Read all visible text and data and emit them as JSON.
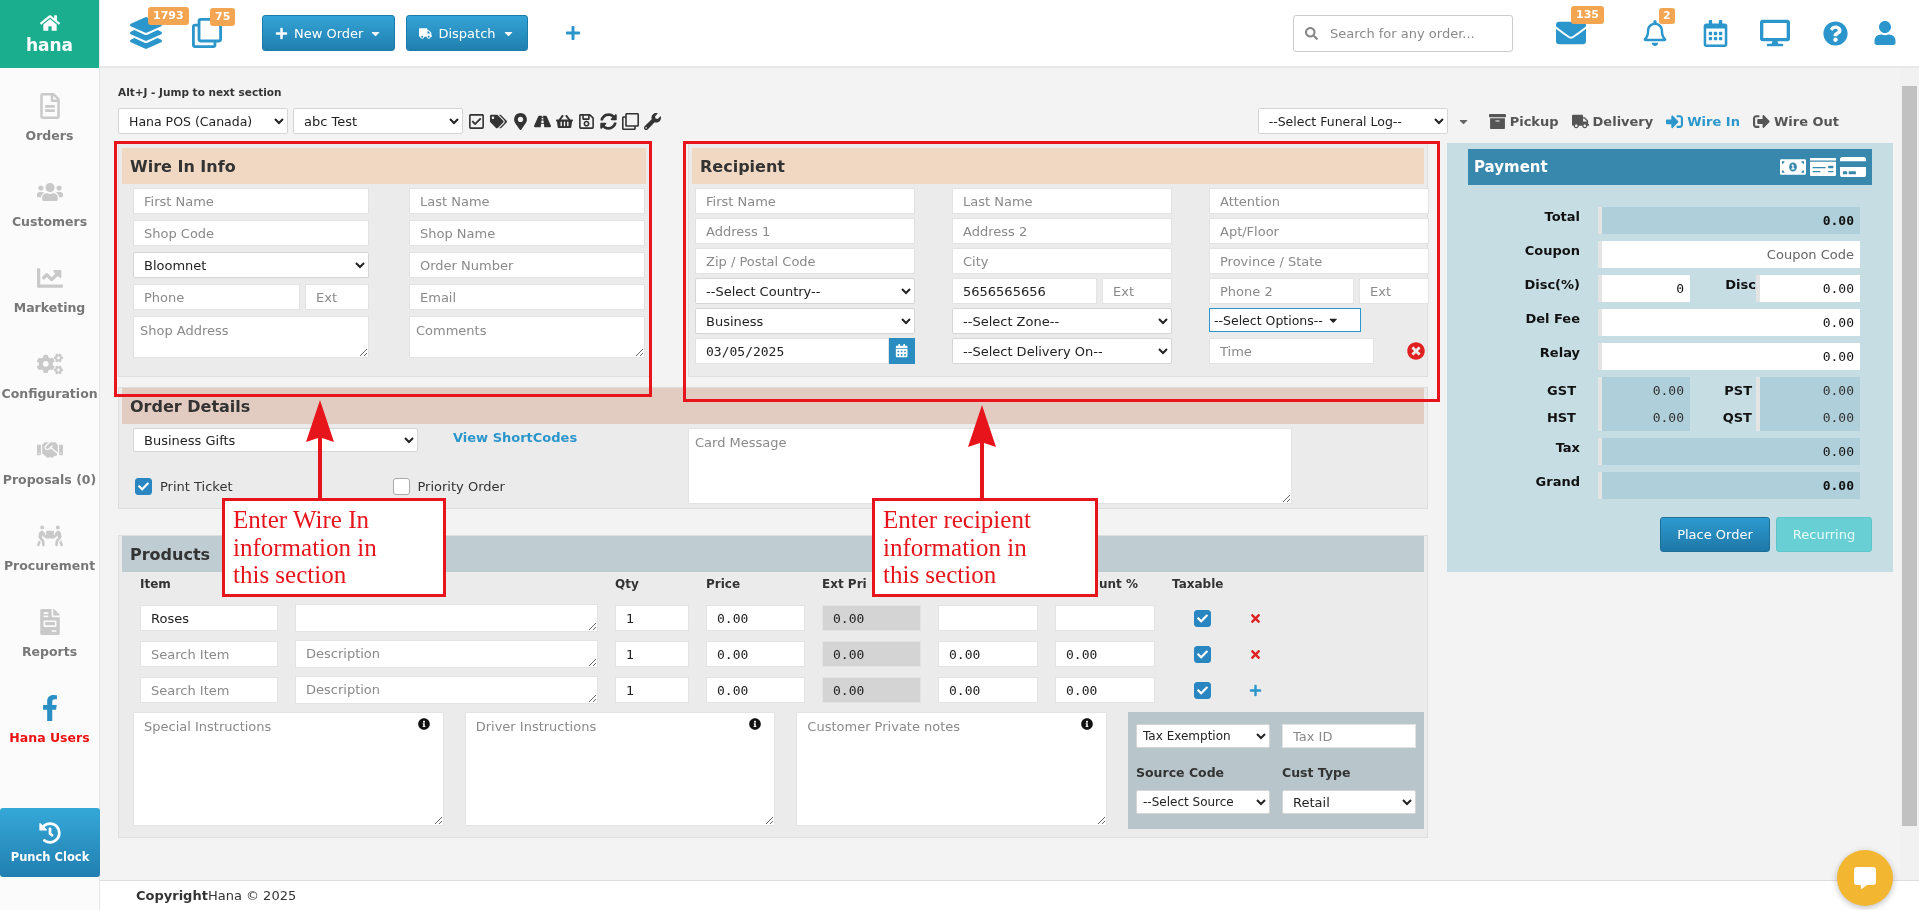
{
  "sidebar": {
    "logo": "hana",
    "items": [
      {
        "label": "Orders",
        "kind": "nav"
      },
      {
        "label": "Customers",
        "kind": "nav"
      },
      {
        "label": "Marketing",
        "kind": "nav"
      },
      {
        "label": "Configuration",
        "kind": "nav"
      },
      {
        "label": "Proposals (0)",
        "kind": "nav"
      },
      {
        "label": "Procurement",
        "kind": "nav"
      },
      {
        "label": "Reports",
        "kind": "nav"
      },
      {
        "label": "Hana Users",
        "kind": "social"
      }
    ],
    "punch_clock": "Punch Clock"
  },
  "topbar": {
    "badges": [
      "1793",
      "75"
    ],
    "buttons": [
      "New Order",
      "Dispatch"
    ],
    "search": {
      "placeholder": "Search for any order..."
    },
    "mail_count": "135",
    "notification_count": "2"
  },
  "toolbar": {
    "hint": "Alt+J - Jump to next section",
    "store": "Hana POS (Canada)",
    "user": "abc Test",
    "funeral_log": "--Select Funeral Log--",
    "order_types": [
      {
        "label": "Pickup",
        "selected": false
      },
      {
        "label": "Delivery",
        "selected": false
      },
      {
        "label": "Wire In",
        "selected": true
      },
      {
        "label": "Wire Out",
        "selected": false
      }
    ]
  },
  "wire_in": {
    "title": "Wire In Info",
    "rows": [
      [
        {
          "kind": "input",
          "placeholder": "First Name"
        },
        {
          "kind": "input",
          "placeholder": "Last Name"
        }
      ],
      [
        {
          "kind": "input",
          "placeholder": "Shop Code"
        },
        {
          "kind": "input",
          "placeholder": "Shop Name"
        }
      ],
      [
        {
          "kind": "select",
          "value": "Bloomnet"
        },
        {
          "kind": "input",
          "placeholder": "Order Number"
        }
      ],
      [
        {
          "kind": "split",
          "fields": [
            {
              "kind": "input",
              "placeholder": "Phone"
            },
            {
              "kind": "input",
              "placeholder": "Ext"
            }
          ]
        },
        {
          "kind": "input",
          "placeholder": "Email"
        }
      ],
      [
        {
          "kind": "textarea",
          "placeholder": "Shop Address"
        },
        {
          "kind": "textarea",
          "placeholder": "Comments"
        }
      ]
    ]
  },
  "recipient": {
    "title": "Recipient",
    "rows": [
      [
        {
          "kind": "input",
          "placeholder": "First Name"
        },
        {
          "kind": "input",
          "placeholder": "Last Name"
        },
        {
          "kind": "input",
          "placeholder": "Attention"
        }
      ],
      [
        {
          "kind": "input",
          "placeholder": "Address 1"
        },
        {
          "kind": "input",
          "placeholder": "Address 2"
        },
        {
          "kind": "input",
          "placeholder": "Apt/Floor"
        }
      ],
      [
        {
          "kind": "input",
          "placeholder": "Zip / Postal Code"
        },
        {
          "kind": "input",
          "placeholder": "City"
        },
        {
          "kind": "input",
          "placeholder": "Province / State"
        }
      ],
      [
        {
          "kind": "select",
          "value": "--Select Country--"
        },
        {
          "kind": "split",
          "fields": [
            {
              "kind": "input",
              "value": "5656565656"
            },
            {
              "kind": "input",
              "placeholder": "Ext"
            }
          ]
        },
        {
          "kind": "split",
          "fields": [
            {
              "kind": "input",
              "placeholder": "Phone 2"
            },
            {
              "kind": "input",
              "placeholder": "Ext"
            }
          ]
        }
      ],
      [
        {
          "kind": "select",
          "value": "Business"
        },
        {
          "kind": "select",
          "value": "--Select Zone--"
        },
        {
          "kind": "options",
          "value": "--Select Options--"
        }
      ],
      [
        {
          "kind": "date",
          "value": "03/05/2025"
        },
        {
          "kind": "select",
          "value": "--Select Delivery On--"
        },
        {
          "kind": "time",
          "placeholder": "Time"
        }
      ]
    ]
  },
  "order_details": {
    "title": "Order Details",
    "occasion": "Business Gifts",
    "shortcodes_link": "View ShortCodes",
    "card_message": {
      "placeholder": "Card Message"
    },
    "checks": [
      {
        "label": "Print Ticket",
        "checked": true
      },
      {
        "label": "Priority Order",
        "checked": false
      }
    ]
  },
  "products": {
    "title": "Products",
    "columns": [
      "Item",
      "Qty",
      "Price",
      "Ext Pri",
      "unt %",
      "Taxable"
    ],
    "rows": [
      {
        "item": {
          "value": "Roses"
        },
        "description": {},
        "qty": "1",
        "price": "0.00",
        "ext_price": "0.00",
        "taxable": true,
        "kind": "existing"
      },
      {
        "item": {
          "placeholder": "Search Item"
        },
        "description": {
          "placeholder": "Description"
        },
        "qty": "1",
        "price": "0.00",
        "ext_price": "0.00",
        "discount": "0.00",
        "discount_pct": "0.00",
        "taxable": true,
        "kind": "existing"
      },
      {
        "item": {
          "placeholder": "Search Item"
        },
        "description": {
          "placeholder": "Description"
        },
        "qty": "1",
        "price": "0.00",
        "ext_price": "0.00",
        "discount": "0.00",
        "discount_pct": "0.00",
        "taxable": true,
        "kind": "new"
      }
    ],
    "notes": [
      {
        "placeholder": "Special Instructions"
      },
      {
        "placeholder": "Driver Instructions"
      },
      {
        "placeholder": "Customer Private notes"
      }
    ],
    "tax_exemption": "Tax Exemption",
    "tax_id": {
      "placeholder": "Tax ID"
    },
    "source_code": {
      "label": "Source Code",
      "value": "--Select Source"
    },
    "cust_type": {
      "label": "Cust Type",
      "value": "Retail"
    }
  },
  "payment": {
    "title": "Payment",
    "rows": [
      {
        "kind": "readonly",
        "strong": true,
        "label": "Total",
        "value": "0.00"
      },
      {
        "kind": "input",
        "label": "Coupon",
        "placeholder": "Coupon Code"
      },
      {
        "kind": "pair",
        "items": [
          {
            "label": "Disc(%)",
            "value": "0"
          },
          {
            "label": "Disc",
            "value": "0.00"
          }
        ]
      },
      {
        "kind": "input",
        "label": "Del Fee",
        "value": "0.00"
      },
      {
        "kind": "input",
        "label": "Relay",
        "value": "0.00"
      },
      {
        "kind": "taxes",
        "items": [
          {
            "label": "GST",
            "value": "0.00"
          },
          {
            "label": "PST",
            "value": "0.00"
          },
          {
            "label": "HST",
            "value": "0.00"
          },
          {
            "label": "QST",
            "value": "0.00"
          }
        ]
      },
      {
        "kind": "readonly",
        "strong": false,
        "label": "Tax",
        "value": "0.00"
      },
      {
        "kind": "readonly",
        "strong": true,
        "label": "Grand",
        "value": "0.00"
      }
    ],
    "buttons": [
      {
        "label": "Place Order",
        "disabled": false
      },
      {
        "label": "Recurring",
        "disabled": true
      }
    ]
  },
  "annotations": [
    {
      "text": "Enter Wire In information in this section"
    },
    {
      "text": "Enter recipient information in this section"
    }
  ],
  "footer": "**Copyright**Hana © 2025"
}
